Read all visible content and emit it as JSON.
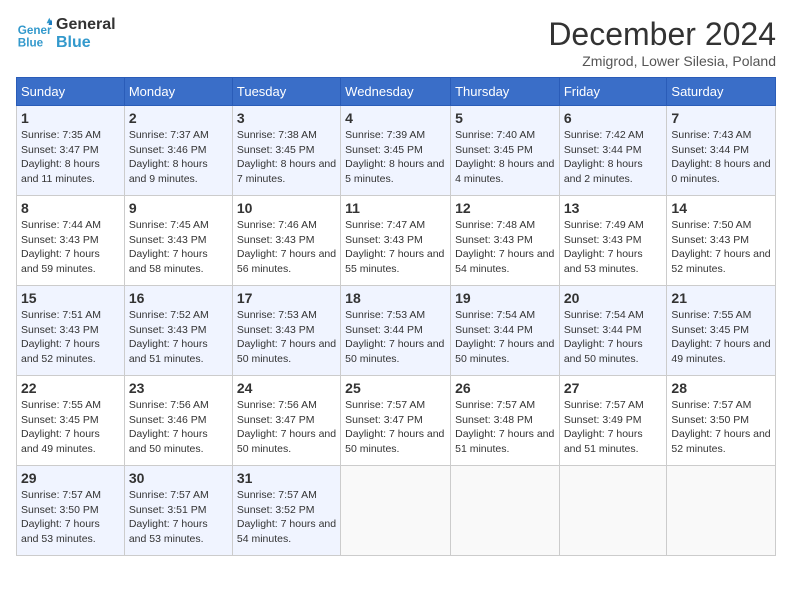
{
  "header": {
    "logo_line1": "General",
    "logo_line2": "Blue",
    "month_title": "December 2024",
    "location": "Zmigrod, Lower Silesia, Poland"
  },
  "weekdays": [
    "Sunday",
    "Monday",
    "Tuesday",
    "Wednesday",
    "Thursday",
    "Friday",
    "Saturday"
  ],
  "weeks": [
    [
      {
        "day": "1",
        "sunrise": "Sunrise: 7:35 AM",
        "sunset": "Sunset: 3:47 PM",
        "daylight": "Daylight: 8 hours and 11 minutes."
      },
      {
        "day": "2",
        "sunrise": "Sunrise: 7:37 AM",
        "sunset": "Sunset: 3:46 PM",
        "daylight": "Daylight: 8 hours and 9 minutes."
      },
      {
        "day": "3",
        "sunrise": "Sunrise: 7:38 AM",
        "sunset": "Sunset: 3:45 PM",
        "daylight": "Daylight: 8 hours and 7 minutes."
      },
      {
        "day": "4",
        "sunrise": "Sunrise: 7:39 AM",
        "sunset": "Sunset: 3:45 PM",
        "daylight": "Daylight: 8 hours and 5 minutes."
      },
      {
        "day": "5",
        "sunrise": "Sunrise: 7:40 AM",
        "sunset": "Sunset: 3:45 PM",
        "daylight": "Daylight: 8 hours and 4 minutes."
      },
      {
        "day": "6",
        "sunrise": "Sunrise: 7:42 AM",
        "sunset": "Sunset: 3:44 PM",
        "daylight": "Daylight: 8 hours and 2 minutes."
      },
      {
        "day": "7",
        "sunrise": "Sunrise: 7:43 AM",
        "sunset": "Sunset: 3:44 PM",
        "daylight": "Daylight: 8 hours and 0 minutes."
      }
    ],
    [
      {
        "day": "8",
        "sunrise": "Sunrise: 7:44 AM",
        "sunset": "Sunset: 3:43 PM",
        "daylight": "Daylight: 7 hours and 59 minutes."
      },
      {
        "day": "9",
        "sunrise": "Sunrise: 7:45 AM",
        "sunset": "Sunset: 3:43 PM",
        "daylight": "Daylight: 7 hours and 58 minutes."
      },
      {
        "day": "10",
        "sunrise": "Sunrise: 7:46 AM",
        "sunset": "Sunset: 3:43 PM",
        "daylight": "Daylight: 7 hours and 56 minutes."
      },
      {
        "day": "11",
        "sunrise": "Sunrise: 7:47 AM",
        "sunset": "Sunset: 3:43 PM",
        "daylight": "Daylight: 7 hours and 55 minutes."
      },
      {
        "day": "12",
        "sunrise": "Sunrise: 7:48 AM",
        "sunset": "Sunset: 3:43 PM",
        "daylight": "Daylight: 7 hours and 54 minutes."
      },
      {
        "day": "13",
        "sunrise": "Sunrise: 7:49 AM",
        "sunset": "Sunset: 3:43 PM",
        "daylight": "Daylight: 7 hours and 53 minutes."
      },
      {
        "day": "14",
        "sunrise": "Sunrise: 7:50 AM",
        "sunset": "Sunset: 3:43 PM",
        "daylight": "Daylight: 7 hours and 52 minutes."
      }
    ],
    [
      {
        "day": "15",
        "sunrise": "Sunrise: 7:51 AM",
        "sunset": "Sunset: 3:43 PM",
        "daylight": "Daylight: 7 hours and 52 minutes."
      },
      {
        "day": "16",
        "sunrise": "Sunrise: 7:52 AM",
        "sunset": "Sunset: 3:43 PM",
        "daylight": "Daylight: 7 hours and 51 minutes."
      },
      {
        "day": "17",
        "sunrise": "Sunrise: 7:53 AM",
        "sunset": "Sunset: 3:43 PM",
        "daylight": "Daylight: 7 hours and 50 minutes."
      },
      {
        "day": "18",
        "sunrise": "Sunrise: 7:53 AM",
        "sunset": "Sunset: 3:44 PM",
        "daylight": "Daylight: 7 hours and 50 minutes."
      },
      {
        "day": "19",
        "sunrise": "Sunrise: 7:54 AM",
        "sunset": "Sunset: 3:44 PM",
        "daylight": "Daylight: 7 hours and 50 minutes."
      },
      {
        "day": "20",
        "sunrise": "Sunrise: 7:54 AM",
        "sunset": "Sunset: 3:44 PM",
        "daylight": "Daylight: 7 hours and 50 minutes."
      },
      {
        "day": "21",
        "sunrise": "Sunrise: 7:55 AM",
        "sunset": "Sunset: 3:45 PM",
        "daylight": "Daylight: 7 hours and 49 minutes."
      }
    ],
    [
      {
        "day": "22",
        "sunrise": "Sunrise: 7:55 AM",
        "sunset": "Sunset: 3:45 PM",
        "daylight": "Daylight: 7 hours and 49 minutes."
      },
      {
        "day": "23",
        "sunrise": "Sunrise: 7:56 AM",
        "sunset": "Sunset: 3:46 PM",
        "daylight": "Daylight: 7 hours and 50 minutes."
      },
      {
        "day": "24",
        "sunrise": "Sunrise: 7:56 AM",
        "sunset": "Sunset: 3:47 PM",
        "daylight": "Daylight: 7 hours and 50 minutes."
      },
      {
        "day": "25",
        "sunrise": "Sunrise: 7:57 AM",
        "sunset": "Sunset: 3:47 PM",
        "daylight": "Daylight: 7 hours and 50 minutes."
      },
      {
        "day": "26",
        "sunrise": "Sunrise: 7:57 AM",
        "sunset": "Sunset: 3:48 PM",
        "daylight": "Daylight: 7 hours and 51 minutes."
      },
      {
        "day": "27",
        "sunrise": "Sunrise: 7:57 AM",
        "sunset": "Sunset: 3:49 PM",
        "daylight": "Daylight: 7 hours and 51 minutes."
      },
      {
        "day": "28",
        "sunrise": "Sunrise: 7:57 AM",
        "sunset": "Sunset: 3:50 PM",
        "daylight": "Daylight: 7 hours and 52 minutes."
      }
    ],
    [
      {
        "day": "29",
        "sunrise": "Sunrise: 7:57 AM",
        "sunset": "Sunset: 3:50 PM",
        "daylight": "Daylight: 7 hours and 53 minutes."
      },
      {
        "day": "30",
        "sunrise": "Sunrise: 7:57 AM",
        "sunset": "Sunset: 3:51 PM",
        "daylight": "Daylight: 7 hours and 53 minutes."
      },
      {
        "day": "31",
        "sunrise": "Sunrise: 7:57 AM",
        "sunset": "Sunset: 3:52 PM",
        "daylight": "Daylight: 7 hours and 54 minutes."
      },
      null,
      null,
      null,
      null
    ]
  ]
}
